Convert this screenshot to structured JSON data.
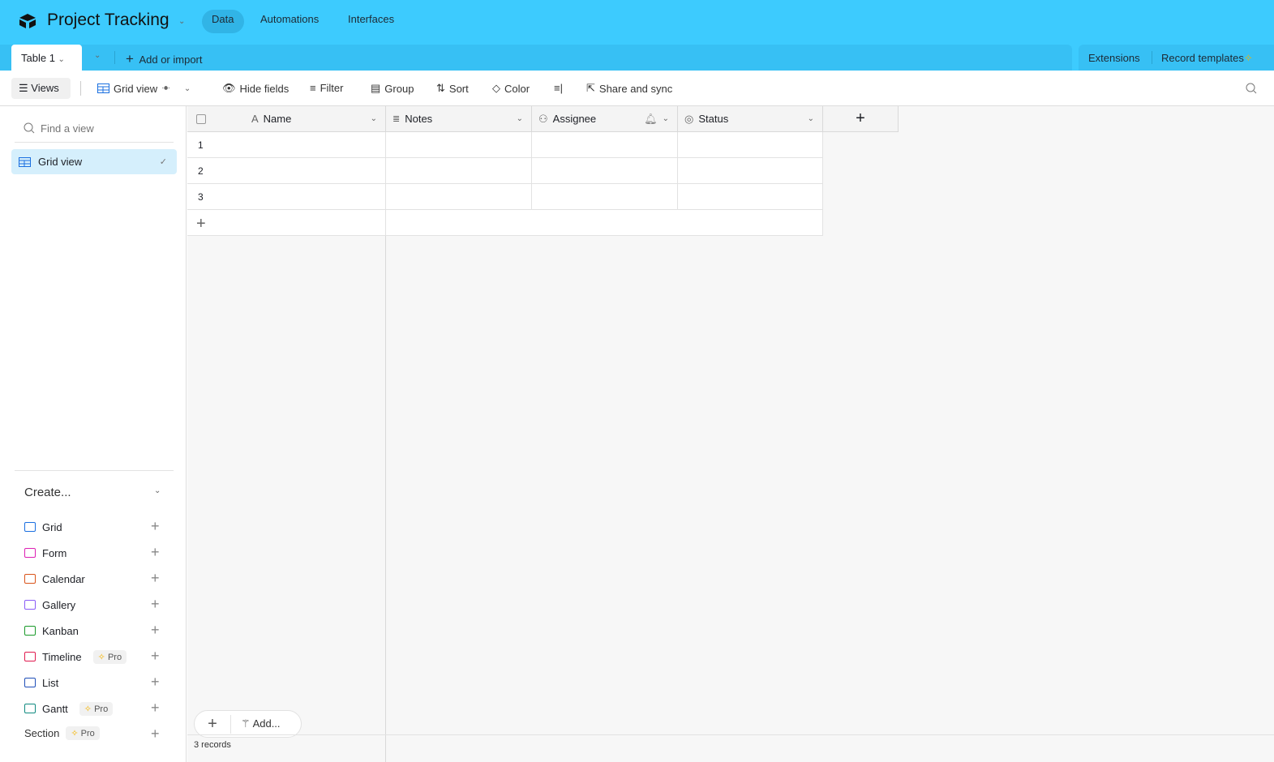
{
  "app": {
    "title": "Project Tracking",
    "nav": [
      "Data",
      "Automations",
      "Interfaces"
    ]
  },
  "tabs": {
    "active": "Table 1",
    "add": "Add or import",
    "extensions": "Extensions",
    "record_templates": "Record templates"
  },
  "toolbar": {
    "views": "Views",
    "view_name": "Grid view",
    "hide_fields": "Hide fields",
    "filter": "Filter",
    "group": "Group",
    "sort": "Sort",
    "color": "Color",
    "share": "Share and sync"
  },
  "sidebar": {
    "find_placeholder": "Find a view",
    "active_view": "Grid view",
    "create_label": "Create...",
    "create_items": [
      {
        "label": "Grid",
        "color": "#1a6fe0",
        "pro": false
      },
      {
        "label": "Form",
        "color": "#dd1fb4",
        "pro": false
      },
      {
        "label": "Calendar",
        "color": "#d9541a",
        "pro": false
      },
      {
        "label": "Gallery",
        "color": "#8b5cf6",
        "pro": false
      },
      {
        "label": "Kanban",
        "color": "#1a9a2a",
        "pro": false
      },
      {
        "label": "Timeline",
        "color": "#e01a4f",
        "pro": true
      },
      {
        "label": "List",
        "color": "#1f4fb8",
        "pro": false
      },
      {
        "label": "Gantt",
        "color": "#108a80",
        "pro": true
      }
    ],
    "section": "Section",
    "pro_label": "Pro"
  },
  "grid": {
    "columns": [
      "Name",
      "Notes",
      "Assignee",
      "Status"
    ],
    "rows": [
      "1",
      "2",
      "3"
    ],
    "add_label": "Add...",
    "record_count": "3 records"
  }
}
